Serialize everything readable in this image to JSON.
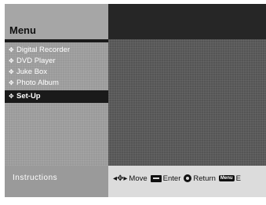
{
  "menu": {
    "title": "Menu",
    "items": [
      {
        "label": "Digital Recorder",
        "selected": false
      },
      {
        "label": "DVD Player",
        "selected": false
      },
      {
        "label": "Juke Box",
        "selected": false
      },
      {
        "label": "Photo Album",
        "selected": false
      },
      {
        "label": "Set-Up",
        "selected": true
      }
    ],
    "bullet_icon": "diamond-bullet-icon"
  },
  "instructions": {
    "label": "Instructions",
    "move_icon": "arrows-icon",
    "move_label": "Move",
    "enter_icon": "enter-key-icon",
    "enter_label": "Enter",
    "return_icon": "return-icon",
    "return_label": "Return",
    "menu_icon_text": "Menu",
    "exit_label": "E"
  },
  "colors": {
    "sidebar": "#9a9a9a",
    "main": "#555555",
    "selected": "#1a1a1a",
    "instruction_bar": "#dcdcdc"
  }
}
